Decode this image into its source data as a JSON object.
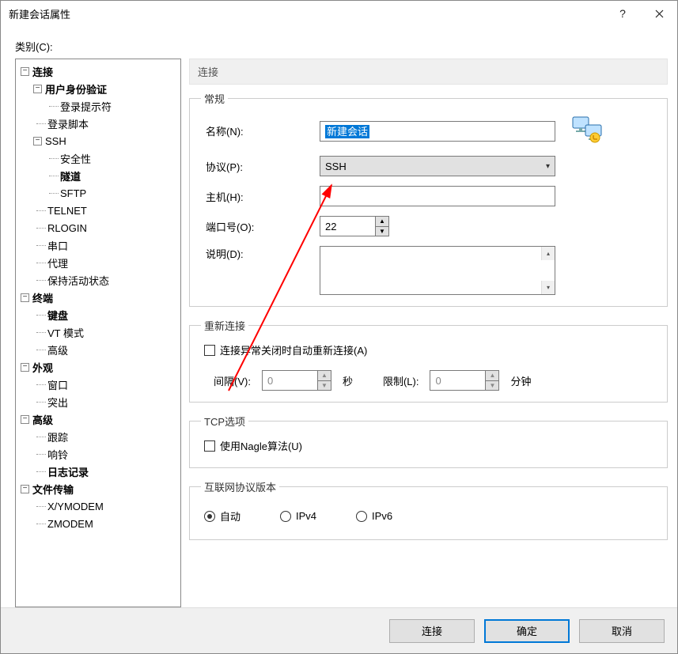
{
  "window": {
    "title": "新建会话属性"
  },
  "category_label": "类别(C):",
  "tree": {
    "connection": "连接",
    "auth": "用户身份验证",
    "login_prompt": "登录提示符",
    "login_script": "登录脚本",
    "ssh": "SSH",
    "security": "安全性",
    "tunnel": "隧道",
    "sftp": "SFTP",
    "telnet": "TELNET",
    "rlogin": "RLOGIN",
    "serial": "串口",
    "proxy": "代理",
    "keepalive": "保持活动状态",
    "terminal": "终端",
    "keyboard": "键盘",
    "vtmode": "VT 模式",
    "advanced_term": "高级",
    "appearance": "外观",
    "window": "窗口",
    "highlight": "突出",
    "advanced": "高级",
    "trace": "跟踪",
    "bell": "响铃",
    "logging": "日志记录",
    "filetransfer": "文件传输",
    "xymodem": "X/YMODEM",
    "zmodem": "ZMODEM"
  },
  "header": {
    "title": "连接"
  },
  "general": {
    "legend": "常规",
    "name_label": "名称(N):",
    "name_value": "新建会话",
    "protocol_label": "协议(P):",
    "protocol_value": "SSH",
    "host_label": "主机(H):",
    "host_value": "",
    "port_label": "端口号(O):",
    "port_value": "22",
    "desc_label": "说明(D):"
  },
  "reconnect": {
    "legend": "重新连接",
    "checkbox_label": "连接异常关闭时自动重新连接(A)",
    "interval_label": "间隔(V):",
    "interval_value": "0",
    "interval_unit": "秒",
    "limit_label": "限制(L):",
    "limit_value": "0",
    "limit_unit": "分钟"
  },
  "tcp": {
    "legend": "TCP选项",
    "nagle_label": "使用Nagle算法(U)"
  },
  "ipver": {
    "legend": "互联网协议版本",
    "auto": "自动",
    "ipv4": "IPv4",
    "ipv6": "IPv6",
    "selected": "auto"
  },
  "footer": {
    "connect": "连接",
    "ok": "确定",
    "cancel": "取消"
  }
}
